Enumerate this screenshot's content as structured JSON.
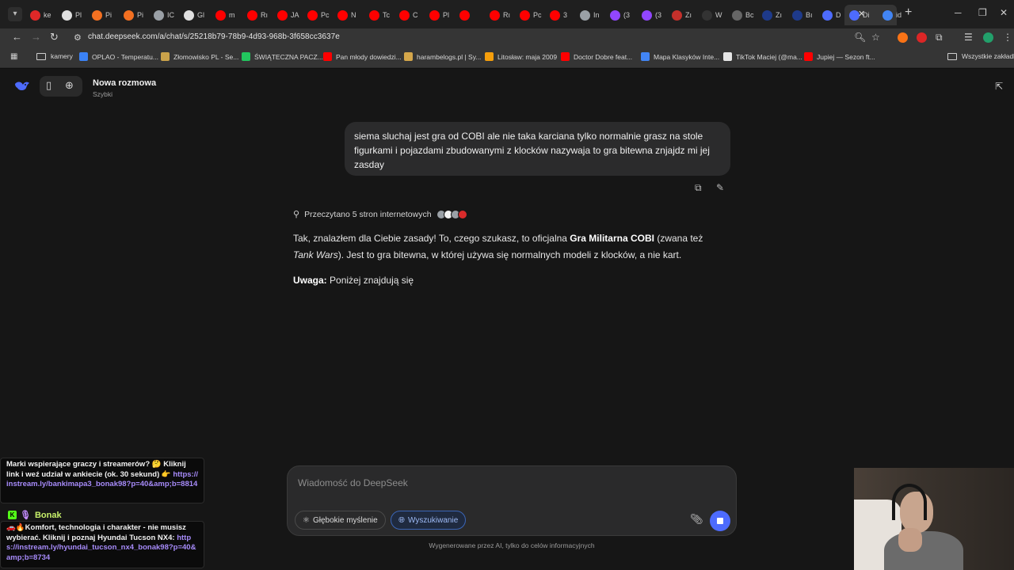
{
  "browser": {
    "tabs": [
      {
        "title": "ke",
        "color": "#e02828"
      },
      {
        "title": "Pl",
        "color": "#e0e0e0"
      },
      {
        "title": "Pi",
        "color": "#f37021"
      },
      {
        "title": "Pi",
        "color": "#f37021"
      },
      {
        "title": "IC",
        "color": "#9aa0a6"
      },
      {
        "title": "Gl",
        "color": "#e0e0e0"
      },
      {
        "title": "m",
        "color": "#ff0000"
      },
      {
        "title": "Rı",
        "color": "#ff0000"
      },
      {
        "title": "JA",
        "color": "#ff0000"
      },
      {
        "title": "Pc",
        "color": "#ff0000"
      },
      {
        "title": "N",
        "color": "#ff0000"
      },
      {
        "title": "Tc",
        "color": "#ff0000"
      },
      {
        "title": "C",
        "color": "#ff0000"
      },
      {
        "title": "Pl",
        "color": "#ff0000"
      },
      {
        "title": "",
        "color": "#ff0000"
      },
      {
        "title": "Rı",
        "color": "#ff0000"
      },
      {
        "title": "Pc",
        "color": "#ff0000"
      },
      {
        "title": "3",
        "color": "#ff0000"
      },
      {
        "title": "In",
        "color": "#9aa0a6"
      },
      {
        "title": "(3",
        "color": "#9146ff"
      },
      {
        "title": "(3",
        "color": "#9146ff"
      },
      {
        "title": "Zı",
        "color": "#c4302b"
      },
      {
        "title": "W",
        "color": "#333333"
      },
      {
        "title": "Bc",
        "color": "#666666"
      },
      {
        "title": "Zı",
        "color": "#1e3a8a"
      },
      {
        "title": "Bı",
        "color": "#1e3a8a"
      },
      {
        "title": "D",
        "color": "#4d6bfe"
      },
      {
        "title": "Di",
        "color": "#4d6bfe"
      },
      {
        "title": "id",
        "color": "#4285f4"
      }
    ],
    "url": "chat.deepseek.com/a/chat/s/25218b79-78b9-4d93-968b-3f658cc3637e",
    "bookmarks": [
      {
        "label": "kamery",
        "type": "folder",
        "color": ""
      },
      {
        "label": "OPLAO - Temperatu...",
        "type": "site",
        "color": "#3b82f6"
      },
      {
        "label": "Złomowisko PL - Se...",
        "type": "site",
        "color": "#caa24a"
      },
      {
        "label": "ŚWIĄTECZNA PACZ...",
        "type": "site",
        "color": "#22c55e"
      },
      {
        "label": "Pan młody dowiedzi...",
        "type": "site",
        "color": "#ff0000"
      },
      {
        "label": "harambelogs.pl | Sy...",
        "type": "site",
        "color": "#d4a64a"
      },
      {
        "label": "Litosław: maja 2009",
        "type": "site",
        "color": "#f59e0b"
      },
      {
        "label": "Doctor Dobre feat...",
        "type": "site",
        "color": "#ff0000"
      },
      {
        "label": "Mapa Klasyków Inte...",
        "type": "site",
        "color": "#4285f4"
      },
      {
        "label": "TikTok Maciej (@ma...",
        "type": "site",
        "color": "#e5e5e5"
      },
      {
        "label": "Jupiej — Sezon ft...",
        "type": "site",
        "color": "#ff0000"
      }
    ],
    "all_bookmarks": "Wszystkie zakładki"
  },
  "app": {
    "chat_title": "Nowa rozmowa",
    "chat_subtitle": "Szybki",
    "user_message": "siema sluchaj jest gra od COBI ale nie taka karciana tylko normalnie grasz na stole figurkami i pojazdami zbudowanymi z klocków nazywaja to gra bitewna znjajdz mi jej zasday",
    "search_status": "Przeczytano 5 stron internetowych",
    "answer": {
      "p1_a": "Tak, znalazłem dla Ciebie zasady! To, czego szukasz, to oficjalna ",
      "p1_b": "Gra Militarna COBI",
      "p1_c": " (zwana też ",
      "p1_d": "Tank Wars",
      "p1_e": "). Jest to gra bitewna, w której używa się normalnych modeli z klocków, a nie kart.",
      "p2_a": "Uwaga:",
      "p2_b": " Poniżej znajdują się"
    },
    "composer": {
      "placeholder": "Wiadomość do DeepSeek",
      "deep_think": "Głębokie myślenie",
      "search": "Wyszukiwanie"
    },
    "disclaimer": "Wygenerowane przez AI, tylko do celów informacyjnych"
  },
  "overlay": {
    "msg1_text": "Marki wspierające graczy i streamerów? 🤔 Kliknij link i weź udział w ankiecie (ok. 30 sekund) 👉",
    "msg1_link": "https://instream.ly/bankimapa3_bonak98?p=40&amp;b=8814",
    "author": "Bonak",
    "msg2_text": "🚗🔥Komfort, technologia i charakter - nie musisz wybierać. Kliknij i poznaj Hyundai Tucson NX4:",
    "msg2_link": "https://instream.ly/hyundai_tucson_nx4_bonak98?p=40&amp;b=8734"
  },
  "colors": {
    "accent": "#4d6bfe",
    "link": "#a78bfa",
    "kick_green": "#53fc18"
  }
}
